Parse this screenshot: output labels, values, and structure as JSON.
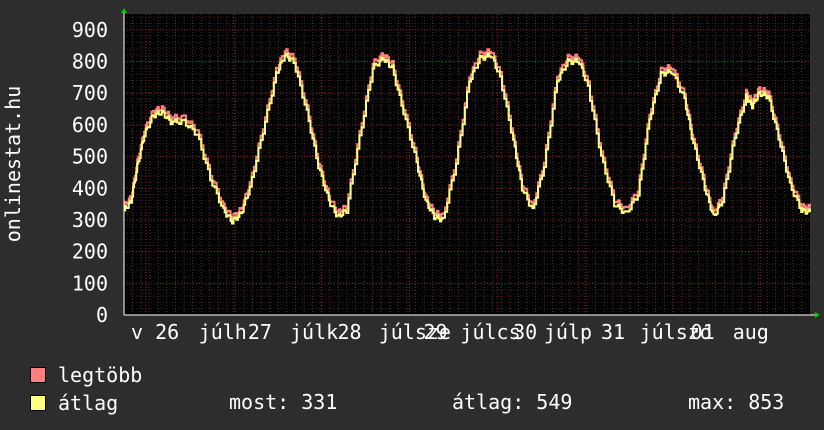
{
  "chart_data": {
    "type": "line",
    "ylabel": "onlinestat.hu",
    "ylim": [
      0,
      950
    ],
    "yticks": [
      0,
      100,
      200,
      300,
      400,
      500,
      600,
      700,
      800,
      900
    ],
    "xlim": [
      -0.33,
      6.9
    ],
    "grid": true,
    "x_labels": [
      {
        "x": -0.25,
        "text": "v 26"
      },
      {
        "x": 0.52,
        "text": "júlh"
      },
      {
        "x": 1.08,
        "text": "27"
      },
      {
        "x": 1.56,
        "text": "júlk"
      },
      {
        "x": 2.1,
        "text": "28"
      },
      {
        "x": 2.57,
        "text": "júlsze"
      },
      {
        "x": 3.08,
        "text": "29"
      },
      {
        "x": 3.5,
        "text": "júlcs"
      },
      {
        "x": 4.1,
        "text": "30"
      },
      {
        "x": 4.45,
        "text": "júlp"
      },
      {
        "x": 5.1,
        "text": "31"
      },
      {
        "x": 5.54,
        "text": "júlszo"
      },
      {
        "x": 6.12,
        "text": "01"
      },
      {
        "x": 6.6,
        "text": "aug"
      }
    ],
    "keypoints": [
      [
        -0.33,
        330
      ],
      [
        -0.25,
        360
      ],
      [
        -0.18,
        470
      ],
      [
        -0.1,
        570
      ],
      [
        0.0,
        630
      ],
      [
        0.1,
        640
      ],
      [
        0.2,
        610
      ],
      [
        0.35,
        610
      ],
      [
        0.5,
        570
      ],
      [
        0.65,
        430
      ],
      [
        0.8,
        330
      ],
      [
        0.9,
        295
      ],
      [
        1.0,
        320
      ],
      [
        1.1,
        400
      ],
      [
        1.25,
        580
      ],
      [
        1.4,
        760
      ],
      [
        1.5,
        820
      ],
      [
        1.6,
        800
      ],
      [
        1.75,
        640
      ],
      [
        1.88,
        470
      ],
      [
        2.0,
        360
      ],
      [
        2.1,
        310
      ],
      [
        2.2,
        330
      ],
      [
        2.35,
        560
      ],
      [
        2.5,
        780
      ],
      [
        2.62,
        810
      ],
      [
        2.72,
        780
      ],
      [
        2.85,
        640
      ],
      [
        3.0,
        480
      ],
      [
        3.1,
        360
      ],
      [
        3.2,
        310
      ],
      [
        3.3,
        300
      ],
      [
        3.45,
        480
      ],
      [
        3.6,
        740
      ],
      [
        3.72,
        810
      ],
      [
        3.85,
        820
      ],
      [
        3.95,
        750
      ],
      [
        4.1,
        550
      ],
      [
        4.2,
        400
      ],
      [
        4.32,
        330
      ],
      [
        4.45,
        470
      ],
      [
        4.6,
        740
      ],
      [
        4.72,
        800
      ],
      [
        4.85,
        800
      ],
      [
        4.95,
        720
      ],
      [
        5.1,
        500
      ],
      [
        5.25,
        350
      ],
      [
        5.38,
        320
      ],
      [
        5.52,
        380
      ],
      [
        5.65,
        620
      ],
      [
        5.78,
        760
      ],
      [
        5.9,
        770
      ],
      [
        6.05,
        680
      ],
      [
        6.15,
        540
      ],
      [
        6.28,
        400
      ],
      [
        6.38,
        310
      ],
      [
        6.48,
        360
      ],
      [
        6.62,
        560
      ],
      [
        6.75,
        690
      ],
      [
        6.82,
        660
      ],
      [
        6.9,
        700
      ],
      [
        7.0,
        690
      ],
      [
        7.12,
        560
      ],
      [
        7.25,
        410
      ],
      [
        7.38,
        330
      ],
      [
        7.48,
        325
      ]
    ],
    "series": [
      {
        "name": "legtöbb",
        "color": "#ff7f7f"
      },
      {
        "name": "átlag",
        "color": "#ffff7f"
      }
    ],
    "stats": {
      "most_label": "most:",
      "most": "331",
      "atlag_label": "átlag:",
      "atlag": "549",
      "max_label": "max:",
      "max": "853"
    }
  }
}
